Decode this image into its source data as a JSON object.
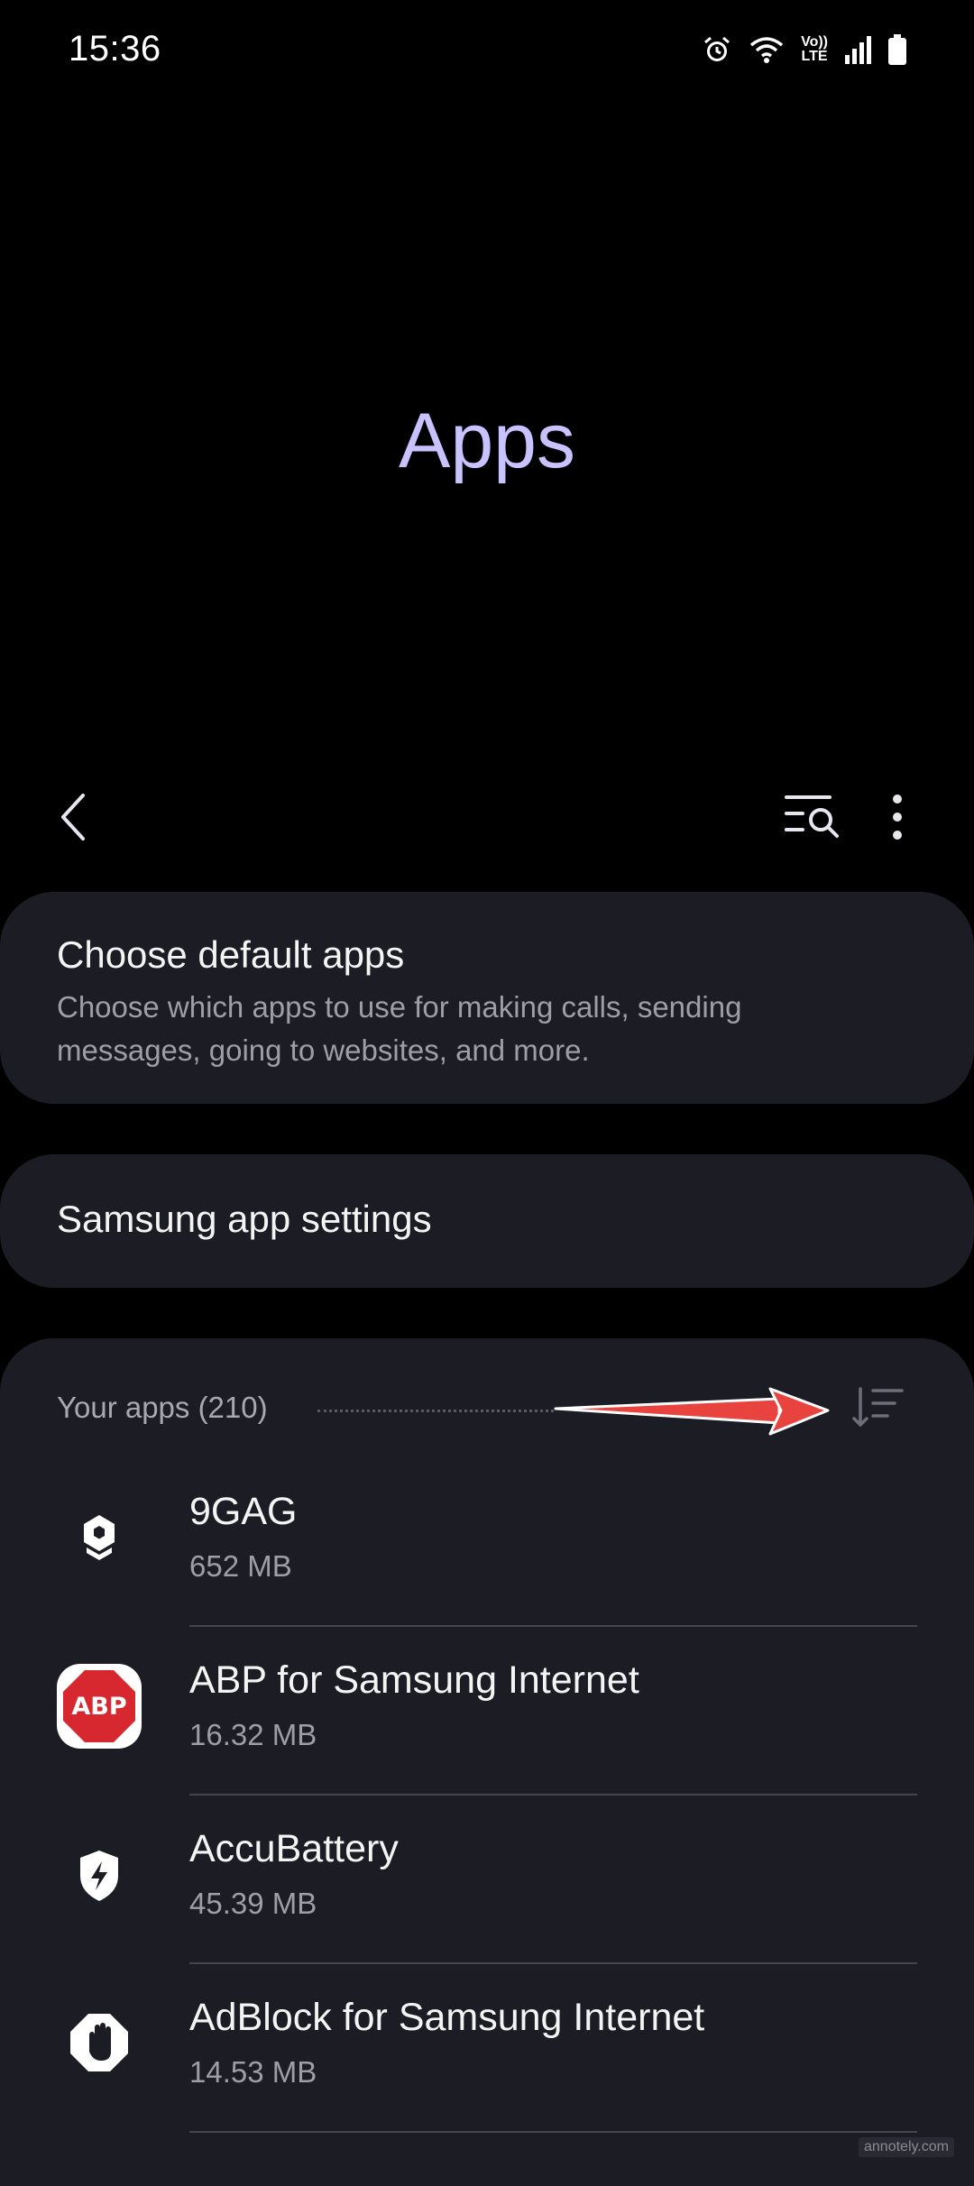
{
  "status_bar": {
    "time": "15:36",
    "volte_top": "Vo))",
    "volte_bottom": "LTE",
    "icons": [
      "alarm-icon",
      "wifi-icon",
      "volte-icon",
      "signal-icon",
      "battery-icon"
    ]
  },
  "header": {
    "title": "Apps"
  },
  "toolbar": {
    "icons": [
      "back-icon",
      "search-list-icon",
      "more-icon"
    ]
  },
  "default_apps": {
    "title": "Choose default apps",
    "subtitle": "Choose which apps to use for making calls, sending messages, going to websites, and more."
  },
  "samsung_settings": {
    "title": "Samsung app settings"
  },
  "your_apps": {
    "header": "Your apps (210)",
    "apps": [
      {
        "name": "9GAG",
        "size": "652 MB",
        "icon": "9gag-icon"
      },
      {
        "name": "ABP for Samsung Internet",
        "size": "16.32 MB",
        "icon": "abp-icon",
        "icon_label": "ABP"
      },
      {
        "name": "AccuBattery",
        "size": "45.39 MB",
        "icon": "accubattery-icon"
      },
      {
        "name": "AdBlock for Samsung Internet",
        "size": "14.53 MB",
        "icon": "adblock-icon"
      }
    ]
  },
  "watermark": "annotely.com",
  "colors": {
    "background": "#000000",
    "card": "#1c1c24",
    "title_accent": "#c8c2ff",
    "arrow": "#e8433f"
  }
}
